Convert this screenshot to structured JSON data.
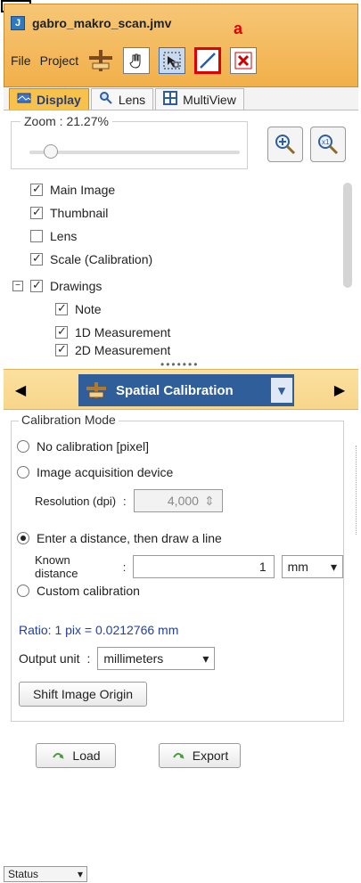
{
  "window": {
    "title": "gabro_makro_scan.jmv",
    "annotation_label": "a"
  },
  "menu": {
    "file": "File",
    "project": "Project"
  },
  "tabs": [
    {
      "label": "Display"
    },
    {
      "label": "Lens"
    },
    {
      "label": "MultiView"
    }
  ],
  "zoom": {
    "label": "Zoom : 21.27%",
    "level_fraction": 0.1
  },
  "layers": [
    {
      "label": "Main Image",
      "checked": true
    },
    {
      "label": "Thumbnail",
      "checked": true
    },
    {
      "label": "Lens",
      "checked": false
    },
    {
      "label": "Scale (Calibration)",
      "checked": true
    },
    {
      "label": "Drawings",
      "checked": true
    },
    {
      "label": "Note",
      "checked": true
    },
    {
      "label": "1D Measurement",
      "checked": true
    },
    {
      "label": "2D Measurement",
      "checked": true
    }
  ],
  "tool_selector": {
    "selected": "Spatial Calibration"
  },
  "calibration": {
    "group_title": "Calibration Mode",
    "options": [
      "No calibration [pixel]",
      "Image acquisition device",
      "Enter a distance, then draw a line",
      "Custom calibration"
    ],
    "selected_option_index": 2,
    "resolution_label": "Resolution (dpi)",
    "resolution_value": "4,000",
    "known_distance_label": "Known distance",
    "known_distance_value": "1",
    "unit": "mm",
    "ratio_text": "Ratio: 1 pix  = 0.0212766 mm",
    "output_unit_label": "Output unit",
    "output_unit": "millimeters",
    "shift_origin_label": "Shift Image Origin"
  },
  "buttons": {
    "load": "Load",
    "export": "Export"
  },
  "status": {
    "label": "Status"
  },
  "colors": {
    "accent_orange": "#f2b04a",
    "selector_blue": "#2f5e9a",
    "highlight_red": "#e10000",
    "ratio_blue": "#2340a0"
  }
}
